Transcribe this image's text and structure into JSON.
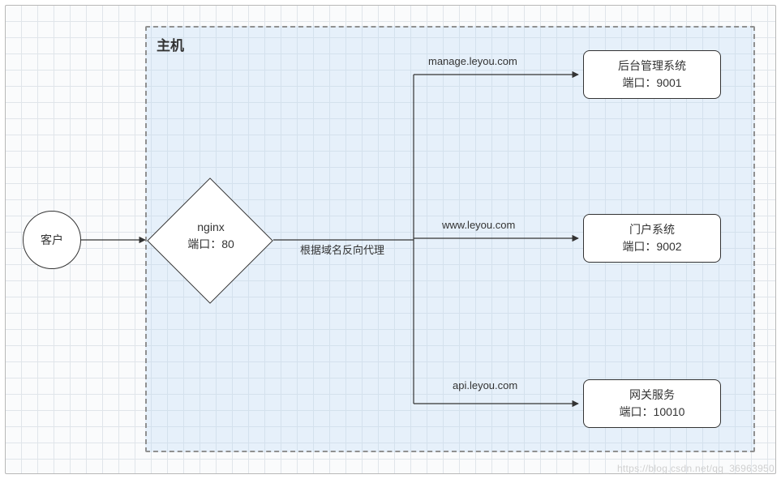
{
  "host": {
    "title": "主机"
  },
  "client": {
    "label": "客户"
  },
  "nginx": {
    "line1": "nginx",
    "line2": "端口：80"
  },
  "proxy_label": "根据域名反向代理",
  "domains": {
    "d1": "manage.leyou.com",
    "d2": "www.leyou.com",
    "d3": "api.leyou.com"
  },
  "services": {
    "s1": {
      "name": "后台管理系统",
      "port": "端口：9001"
    },
    "s2": {
      "name": "门户系统",
      "port": "端口：9002"
    },
    "s3": {
      "name": "网关服务",
      "port": "端口：10010"
    }
  },
  "watermark": "https://blog.csdn.net/qq_36963950"
}
